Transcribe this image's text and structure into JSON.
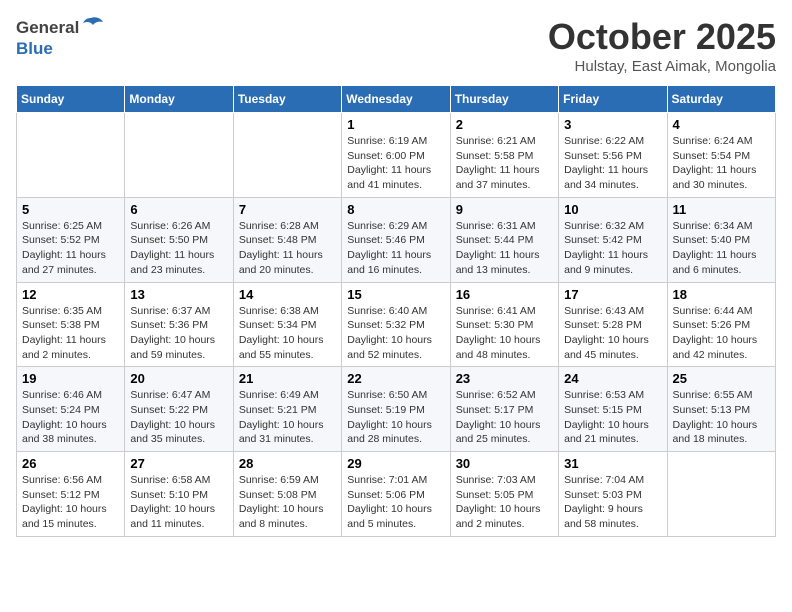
{
  "header": {
    "logo_general": "General",
    "logo_blue": "Blue",
    "month_title": "October 2025",
    "subtitle": "Hulstay, East Aimak, Mongolia"
  },
  "days_of_week": [
    "Sunday",
    "Monday",
    "Tuesday",
    "Wednesday",
    "Thursday",
    "Friday",
    "Saturday"
  ],
  "weeks": [
    [
      {
        "day": "",
        "info": ""
      },
      {
        "day": "",
        "info": ""
      },
      {
        "day": "",
        "info": ""
      },
      {
        "day": "1",
        "info": "Sunrise: 6:19 AM\nSunset: 6:00 PM\nDaylight: 11 hours\nand 41 minutes."
      },
      {
        "day": "2",
        "info": "Sunrise: 6:21 AM\nSunset: 5:58 PM\nDaylight: 11 hours\nand 37 minutes."
      },
      {
        "day": "3",
        "info": "Sunrise: 6:22 AM\nSunset: 5:56 PM\nDaylight: 11 hours\nand 34 minutes."
      },
      {
        "day": "4",
        "info": "Sunrise: 6:24 AM\nSunset: 5:54 PM\nDaylight: 11 hours\nand 30 minutes."
      }
    ],
    [
      {
        "day": "5",
        "info": "Sunrise: 6:25 AM\nSunset: 5:52 PM\nDaylight: 11 hours\nand 27 minutes."
      },
      {
        "day": "6",
        "info": "Sunrise: 6:26 AM\nSunset: 5:50 PM\nDaylight: 11 hours\nand 23 minutes."
      },
      {
        "day": "7",
        "info": "Sunrise: 6:28 AM\nSunset: 5:48 PM\nDaylight: 11 hours\nand 20 minutes."
      },
      {
        "day": "8",
        "info": "Sunrise: 6:29 AM\nSunset: 5:46 PM\nDaylight: 11 hours\nand 16 minutes."
      },
      {
        "day": "9",
        "info": "Sunrise: 6:31 AM\nSunset: 5:44 PM\nDaylight: 11 hours\nand 13 minutes."
      },
      {
        "day": "10",
        "info": "Sunrise: 6:32 AM\nSunset: 5:42 PM\nDaylight: 11 hours\nand 9 minutes."
      },
      {
        "day": "11",
        "info": "Sunrise: 6:34 AM\nSunset: 5:40 PM\nDaylight: 11 hours\nand 6 minutes."
      }
    ],
    [
      {
        "day": "12",
        "info": "Sunrise: 6:35 AM\nSunset: 5:38 PM\nDaylight: 11 hours\nand 2 minutes."
      },
      {
        "day": "13",
        "info": "Sunrise: 6:37 AM\nSunset: 5:36 PM\nDaylight: 10 hours\nand 59 minutes."
      },
      {
        "day": "14",
        "info": "Sunrise: 6:38 AM\nSunset: 5:34 PM\nDaylight: 10 hours\nand 55 minutes."
      },
      {
        "day": "15",
        "info": "Sunrise: 6:40 AM\nSunset: 5:32 PM\nDaylight: 10 hours\nand 52 minutes."
      },
      {
        "day": "16",
        "info": "Sunrise: 6:41 AM\nSunset: 5:30 PM\nDaylight: 10 hours\nand 48 minutes."
      },
      {
        "day": "17",
        "info": "Sunrise: 6:43 AM\nSunset: 5:28 PM\nDaylight: 10 hours\nand 45 minutes."
      },
      {
        "day": "18",
        "info": "Sunrise: 6:44 AM\nSunset: 5:26 PM\nDaylight: 10 hours\nand 42 minutes."
      }
    ],
    [
      {
        "day": "19",
        "info": "Sunrise: 6:46 AM\nSunset: 5:24 PM\nDaylight: 10 hours\nand 38 minutes."
      },
      {
        "day": "20",
        "info": "Sunrise: 6:47 AM\nSunset: 5:22 PM\nDaylight: 10 hours\nand 35 minutes."
      },
      {
        "day": "21",
        "info": "Sunrise: 6:49 AM\nSunset: 5:21 PM\nDaylight: 10 hours\nand 31 minutes."
      },
      {
        "day": "22",
        "info": "Sunrise: 6:50 AM\nSunset: 5:19 PM\nDaylight: 10 hours\nand 28 minutes."
      },
      {
        "day": "23",
        "info": "Sunrise: 6:52 AM\nSunset: 5:17 PM\nDaylight: 10 hours\nand 25 minutes."
      },
      {
        "day": "24",
        "info": "Sunrise: 6:53 AM\nSunset: 5:15 PM\nDaylight: 10 hours\nand 21 minutes."
      },
      {
        "day": "25",
        "info": "Sunrise: 6:55 AM\nSunset: 5:13 PM\nDaylight: 10 hours\nand 18 minutes."
      }
    ],
    [
      {
        "day": "26",
        "info": "Sunrise: 6:56 AM\nSunset: 5:12 PM\nDaylight: 10 hours\nand 15 minutes."
      },
      {
        "day": "27",
        "info": "Sunrise: 6:58 AM\nSunset: 5:10 PM\nDaylight: 10 hours\nand 11 minutes."
      },
      {
        "day": "28",
        "info": "Sunrise: 6:59 AM\nSunset: 5:08 PM\nDaylight: 10 hours\nand 8 minutes."
      },
      {
        "day": "29",
        "info": "Sunrise: 7:01 AM\nSunset: 5:06 PM\nDaylight: 10 hours\nand 5 minutes."
      },
      {
        "day": "30",
        "info": "Sunrise: 7:03 AM\nSunset: 5:05 PM\nDaylight: 10 hours\nand 2 minutes."
      },
      {
        "day": "31",
        "info": "Sunrise: 7:04 AM\nSunset: 5:03 PM\nDaylight: 9 hours\nand 58 minutes."
      },
      {
        "day": "",
        "info": ""
      }
    ]
  ]
}
